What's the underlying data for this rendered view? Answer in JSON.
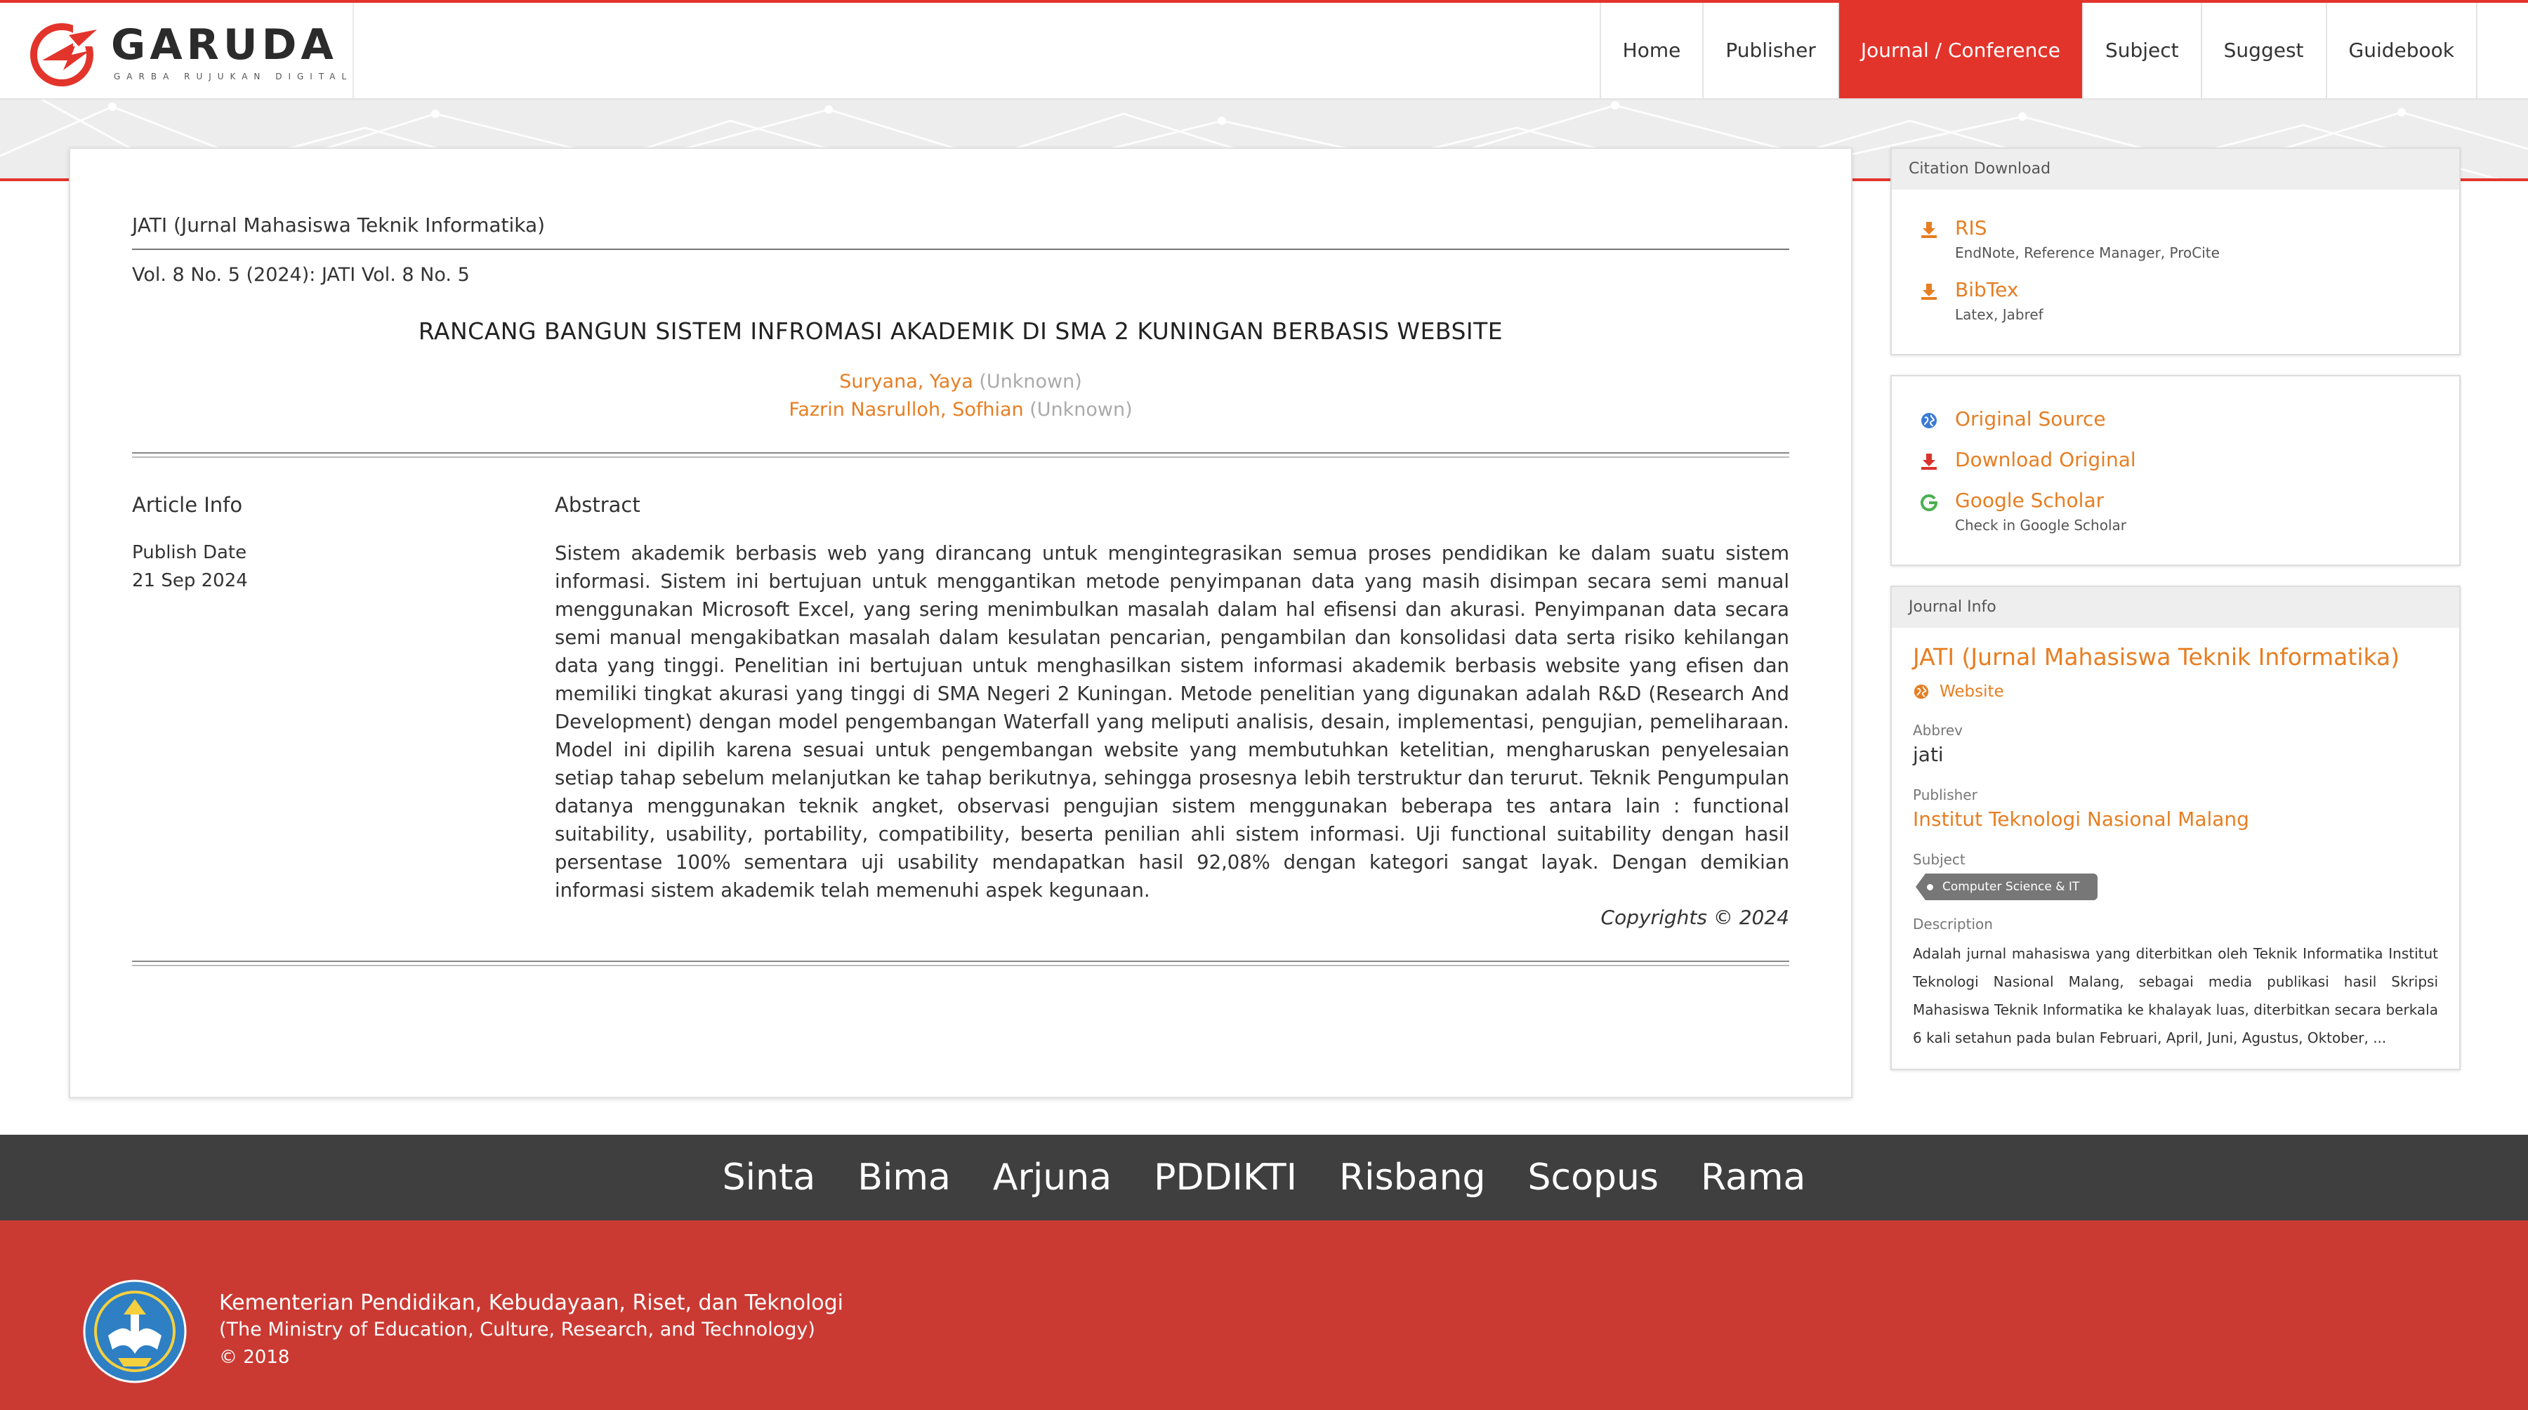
{
  "brand": {
    "name": "GARUDA",
    "tagline": "GARBA RUJUKAN DIGITAL",
    "accent_color": "#e3342b",
    "logo_icon": "garuda-logo-icon"
  },
  "nav": {
    "items": [
      {
        "label": "Home"
      },
      {
        "label": "Publisher"
      },
      {
        "label": "Journal / Conference"
      },
      {
        "label": "Subject"
      },
      {
        "label": "Suggest"
      },
      {
        "label": "Guidebook"
      }
    ],
    "active": "Journal / Conference"
  },
  "article": {
    "journal": "JATI (Jurnal Mahasiswa Teknik Informatika)",
    "volume": "Vol. 8 No. 5 (2024): JATI Vol. 8 No. 5",
    "title": "RANCANG BANGUN SISTEM INFROMASI AKADEMIK DI SMA 2 KUNINGAN BERBASIS WEBSITE",
    "authors": [
      {
        "name": "Suryana, Yaya",
        "affiliation": "(Unknown)"
      },
      {
        "name": "Fazrin Nasrulloh, Sofhian",
        "affiliation": "(Unknown)"
      }
    ],
    "info_heading": "Article Info",
    "publish_label": "Publish Date",
    "publish_date": "21 Sep 2024",
    "abstract_heading": "Abstract",
    "abstract": "Sistem akademik berbasis web yang dirancang untuk mengintegrasikan semua proses pendidikan ke dalam suatu sistem informasi. Sistem ini bertujuan untuk menggantikan metode penyimpanan data yang masih disimpan secara semi manual menggunakan Microsoft Excel, yang sering menimbulkan masalah dalam hal efisensi dan akurasi. Penyimpanan data secara semi manual mengakibatkan masalah dalam kesulatan pencarian, pengambilan dan konsolidasi data serta risiko kehilangan data yang tinggi. Penelitian ini bertujuan untuk menghasilkan sistem informasi akademik berbasis website yang efisen dan memiliki tingkat akurasi yang tinggi di SMA Negeri 2 Kuningan. Metode penelitian yang digunakan adalah R&D (Research And Development) dengan model pengembangan Waterfall yang meliputi analisis, desain, implementasi, pengujian, pemeliharaan. Model ini dipilih karena sesuai untuk pengembangan website yang membutuhkan ketelitian, mengharuskan penyelesaian setiap tahap sebelum melanjutkan ke tahap berikutnya, sehingga prosesnya lebih terstruktur dan terurut. Teknik Pengumpulan datanya menggunakan teknik angket, observasi pengujian sistem menggunakan beberapa tes antara lain : functional suitability, usability, portability, compatibility, beserta penilian ahli sistem informasi. Uji functional suitability dengan hasil persentase 100% sementara uji usability mendapatkan hasil 92,08% dengan kategori sangat layak. Dengan demikian informasi sistem akademik telah memenuhi aspek kegunaan.",
    "copyright": "Copyrights © 2024"
  },
  "citation": {
    "heading": "Citation Download",
    "items": [
      {
        "label": "RIS",
        "sub": "EndNote, Reference Manager, ProCite",
        "icon": "download-icon"
      },
      {
        "label": "BibTex",
        "sub": "Latex, Jabref",
        "icon": "download-icon"
      }
    ]
  },
  "sources": {
    "original_source": "Original Source",
    "download_original": "Download Original",
    "google_scholar": "Google Scholar",
    "google_scholar_sub": "Check in Google Scholar"
  },
  "journal_info": {
    "heading": "Journal Info",
    "title": "JATI (Jurnal Mahasiswa Teknik Informatika)",
    "website": "Website",
    "abbrev_label": "Abbrev",
    "abbrev": "jati",
    "publisher_label": "Publisher",
    "publisher": "Institut Teknologi Nasional Malang",
    "subject_label": "Subject",
    "subject": "Computer Science & IT",
    "description_label": "Description",
    "description": "Adalah jurnal mahasiswa yang diterbitkan oleh Teknik Informatika Institut Teknologi Nasional Malang, sebagai media publikasi hasil Skripsi Mahasiswa Teknik Informatika ke khalayak luas, diterbitkan secara berkala 6 kali setahun pada bulan Februari, April, Juni, Agustus, Oktober, ..."
  },
  "footer_links": [
    "Sinta",
    "Bima",
    "Arjuna",
    "PDDIKTI",
    "Risbang",
    "Scopus",
    "Rama"
  ],
  "footer": {
    "line1": "Kementerian Pendidikan, Kebudayaan, Riset, dan Teknologi",
    "line2": "(The Ministry of Education, Culture, Research, and Technology)",
    "line3": "© 2018",
    "emblem_icon": "tut-wuri-handayani-emblem"
  },
  "colors": {
    "link_orange": "#e67e22",
    "footer_red": "#ca3a33",
    "linkbar_gray": "#3f3f3f"
  }
}
